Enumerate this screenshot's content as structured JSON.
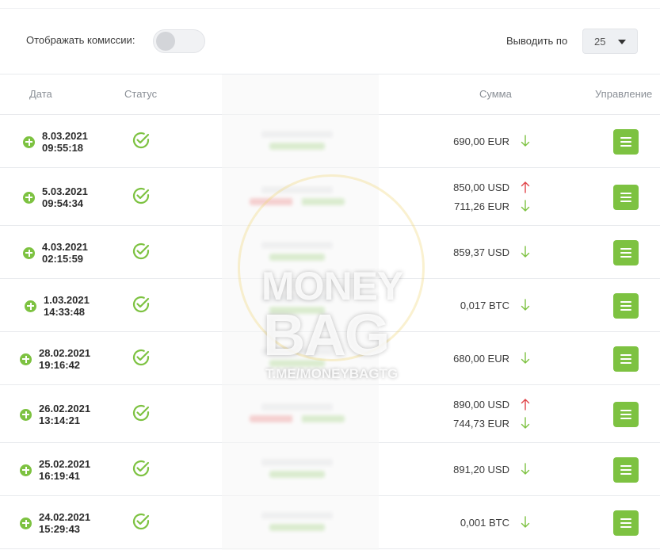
{
  "toolbar": {
    "show_fees_label": "Отображать комиссии:",
    "show_fees_enabled": false,
    "per_page_label": "Выводить по",
    "per_page_value": "25"
  },
  "table": {
    "headers": {
      "date": "Дата",
      "status": "Статус",
      "amount": "Сумма",
      "manage": "Управление"
    },
    "rows": [
      {
        "date": "8.03.2021",
        "time": "09:55:18",
        "amounts": [
          {
            "text": "690,00 EUR",
            "dir": "down"
          }
        ]
      },
      {
        "date": "5.03.2021",
        "time": "09:54:34",
        "amounts": [
          {
            "text": "850,00 USD",
            "dir": "up"
          },
          {
            "text": "711,26 EUR",
            "dir": "down"
          }
        ]
      },
      {
        "date": "4.03.2021",
        "time": "02:15:59",
        "amounts": [
          {
            "text": "859,37 USD",
            "dir": "down"
          }
        ]
      },
      {
        "date": "1.03.2021",
        "time": "14:33:48",
        "amounts": [
          {
            "text": "0,017 BTC",
            "dir": "down"
          }
        ]
      },
      {
        "date": "28.02.2021",
        "time": "19:16:42",
        "amounts": [
          {
            "text": "680,00 EUR",
            "dir": "down"
          }
        ]
      },
      {
        "date": "26.02.2021",
        "time": "13:14:21",
        "amounts": [
          {
            "text": "890,00 USD",
            "dir": "up"
          },
          {
            "text": "744,73 EUR",
            "dir": "down"
          }
        ]
      },
      {
        "date": "25.02.2021",
        "time": "16:19:41",
        "amounts": [
          {
            "text": "891,20 USD",
            "dir": "down"
          }
        ]
      },
      {
        "date": "24.02.2021",
        "time": "15:29:43",
        "amounts": [
          {
            "text": "0,001 BTC",
            "dir": "down"
          }
        ]
      }
    ]
  },
  "watermark": {
    "line1": "MONEY",
    "line2": "BAG",
    "line3": "T.ME/MONEYBAGTG"
  },
  "colors": {
    "accent_green": "#7dc241",
    "arrow_up": "#e0454a",
    "arrow_down": "#7dc241"
  },
  "icons": {
    "add": "plus-circle-icon",
    "status": "check-circle-icon",
    "manage": "menu-lines-icon",
    "amount_up": "arrow-up-icon",
    "amount_down": "arrow-down-icon"
  }
}
